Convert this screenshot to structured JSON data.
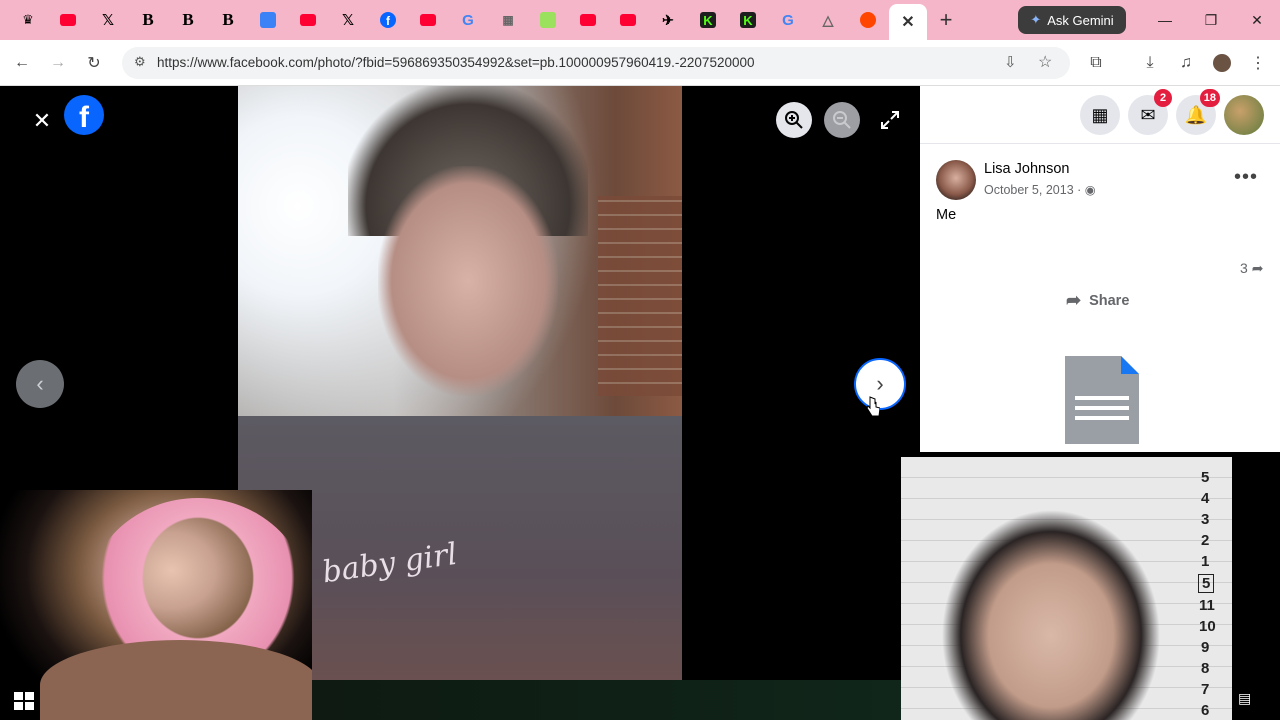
{
  "browser": {
    "tabs_count": 22,
    "new_tab_label": "+",
    "ask_gemini_label": "Ask Gemini",
    "url": "https://www.facebook.com/photo/?fbid=596869350354992&set=pb.100000957960419.-2207520000"
  },
  "viewer": {
    "close_label": "✕",
    "prev_label": "‹",
    "next_label": "›",
    "shirt_text": "baby girl"
  },
  "header": {
    "messenger_badge": "2",
    "notifications_badge": "18"
  },
  "post": {
    "author_name": "Lisa Johnson",
    "date": "October 5, 2013 · ",
    "caption": "Me",
    "share_count": "3",
    "share_label": "Share",
    "more_label": "•••"
  },
  "mugshot": {
    "ruler_marks": [
      "5",
      "4",
      "3",
      "2",
      "1",
      "5",
      "11",
      "10",
      "9",
      "8",
      "7",
      "6"
    ]
  },
  "colors": {
    "tabstrip": "#f6b6c9",
    "facebook_blue": "#0866ff",
    "badge_red": "#e41e3f"
  }
}
